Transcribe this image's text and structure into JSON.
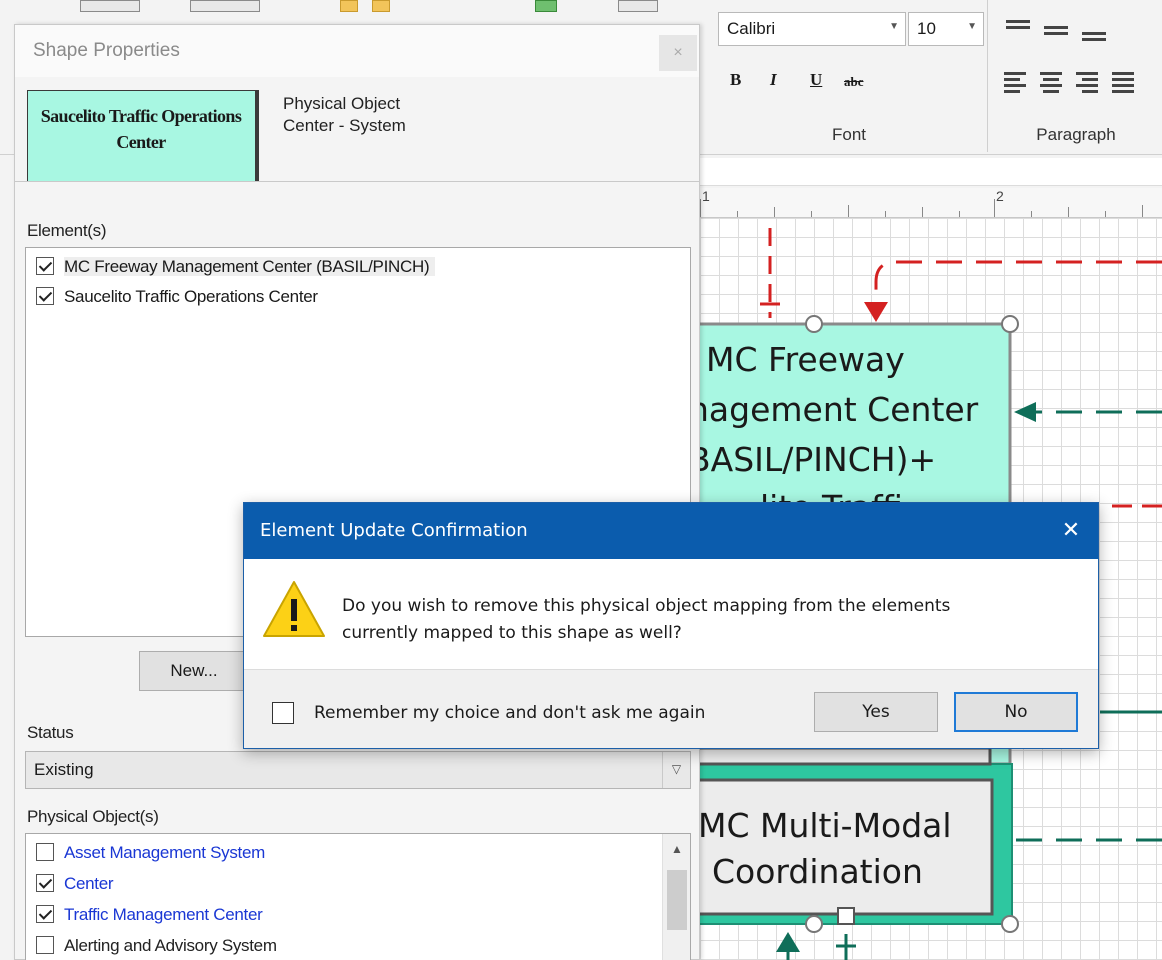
{
  "ribbon": {
    "font_name": "Calibri",
    "font_size": "10",
    "bold_label": "B",
    "italic_label": "I",
    "underline_label": "U",
    "strike_label": "abc",
    "font_group_label": "Font",
    "paragraph_group_label": "Paragraph"
  },
  "ruler": {
    "mark_1": "1",
    "mark_2": "2"
  },
  "canvas": {
    "shape_top_lines": [
      "MC Freeway",
      "nagement Center",
      "BASIL/PINCH)+",
      "lito Traffi"
    ],
    "shape_bottom_lines": [
      "MC Multi-Modal",
      "Coordination"
    ]
  },
  "shape_properties": {
    "title": "Shape Properties",
    "close_label": "×",
    "tab_shape_label": "Saucelito Traffic Operations Center",
    "tab_object_line1": "Physical Object",
    "tab_object_line2": "Center - System",
    "elements_label": "Element(s)",
    "elements": [
      {
        "label": "MC Freeway Management Center (BASIL/PINCH)",
        "checked": true
      },
      {
        "label": "Saucelito Traffic Operations Center",
        "checked": true
      }
    ],
    "new_button_label": "New...",
    "status_label": "Status",
    "status_value": "Existing",
    "physical_objects_label": "Physical Object(s)",
    "physical_objects": [
      {
        "label": "Asset Management System",
        "checked": false
      },
      {
        "label": "Center",
        "checked": true
      },
      {
        "label": "Traffic Management Center",
        "checked": true
      },
      {
        "label": "Alerting and Advisory System",
        "checked": false
      }
    ]
  },
  "dialog": {
    "title": "Element Update Confirmation",
    "close_label": "✕",
    "message_line1": "Do you wish to remove this physical object mapping from the elements",
    "message_line2": "currently mapped to this shape as well?",
    "remember_label": "Remember my choice and don't ask me again",
    "remember_checked": false,
    "yes_label": "Yes",
    "no_label": "No",
    "icon": "warning-icon",
    "accent_color": "#0b5cad"
  },
  "colors": {
    "shape_fill": "#a8f7e2",
    "link_text": "#1a37d4",
    "flow_red": "#d42121",
    "flow_green": "#0f6e59"
  }
}
